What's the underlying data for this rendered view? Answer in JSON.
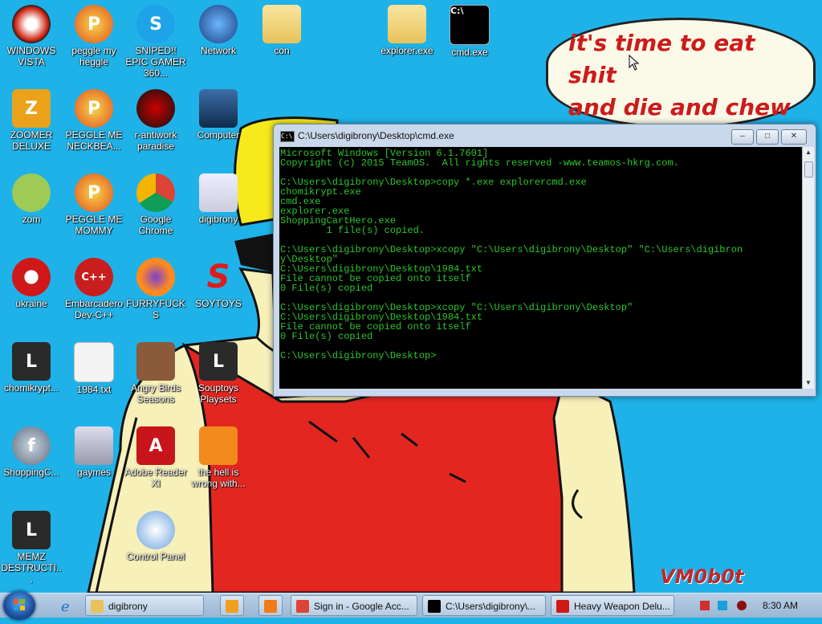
{
  "desktop_icons": [
    {
      "label": "WINDOWS VISTA",
      "icon": "vista-orb-icon"
    },
    {
      "label": "peggle my heggle",
      "icon": "peggle-icon"
    },
    {
      "label": "SNIPED!! EPIC GAMER 360...",
      "icon": "skype-icon"
    },
    {
      "label": "Network",
      "icon": "network-icon"
    },
    {
      "label": "con",
      "icon": "folder-icon"
    },
    {
      "label": "explorer.exe",
      "icon": "folder-icon"
    },
    {
      "label": "cmd.exe",
      "icon": "cmd-icon"
    },
    {
      "label": "ZOOMER DELUXE",
      "icon": "zuma-icon"
    },
    {
      "label": "PEGGLE ME NECKBEA...",
      "icon": "peggle-icon"
    },
    {
      "label": "r-antiwork paradise",
      "icon": "reddit-icon"
    },
    {
      "label": "Computer",
      "icon": "computer-icon"
    },
    {
      "label": "zom",
      "icon": "plants-icon"
    },
    {
      "label": "PEGGLE ME MOMMY",
      "icon": "peggle-icon"
    },
    {
      "label": "Google Chrome",
      "icon": "chrome-icon"
    },
    {
      "label": "digibrony",
      "icon": "user-folder-icon"
    },
    {
      "label": "ukraine",
      "icon": "radiation-icon"
    },
    {
      "label": "Embarcadero Dev-C++",
      "icon": "devcpp-icon"
    },
    {
      "label": "FURRYFUCKS",
      "icon": "firefox-icon"
    },
    {
      "label": "SOYTOYS",
      "icon": "soy-s-icon"
    },
    {
      "label": "chomikrypt...",
      "icon": "memz-icon"
    },
    {
      "label": "1984.txt",
      "icon": "text-file-icon"
    },
    {
      "label": "Angry Birds Seasons",
      "icon": "angry-birds-icon"
    },
    {
      "label": "Souptoys Playsets",
      "icon": "memz-icon"
    },
    {
      "label": "ShoppingC...",
      "icon": "flash-icon"
    },
    {
      "label": "gaymes",
      "icon": "games-folder-icon"
    },
    {
      "label": "Adobe Reader XI",
      "icon": "adobe-icon"
    },
    {
      "label": "the hell is wrong with...",
      "icon": "uc-browser-icon"
    },
    {
      "label": "MEMZ DESTRUCTI...",
      "icon": "memz-icon"
    },
    {
      "label": "Control Panel",
      "icon": "control-panel-icon"
    }
  ],
  "speech_bubble": "it's time to eat shit\nand die and chew\nbubble gum",
  "signature": "VM0b0t",
  "cmd_window": {
    "title": "C:\\Users\\digibrony\\Desktop\\cmd.exe",
    "lines": [
      "Microsoft Windows [Version 6.1.7601]",
      "Copyright (c) 2015 TeamOS.  All rights reserved -www.teamos-hkrg.com.",
      "",
      "C:\\Users\\digibrony\\Desktop>copy *.exe explorercmd.exe",
      "chomikrypt.exe",
      "cmd.exe",
      "explorer.exe",
      "ShoppingCartHero.exe",
      "        1 file(s) copied.",
      "",
      "C:\\Users\\digibrony\\Desktop>xcopy \"C:\\Users\\digibrony\\Desktop\" \"C:\\Users\\digibron",
      "y\\Desktop\"",
      "C:\\Users\\digibrony\\Desktop\\1984.txt",
      "File cannot be copied onto itself",
      "0 File(s) copied",
      "",
      "C:\\Users\\digibrony\\Desktop>xcopy \"C:\\Users\\digibrony\\Desktop\"",
      "C:\\Users\\digibrony\\Desktop\\1984.txt",
      "File cannot be copied onto itself",
      "0 File(s) copied",
      "",
      "C:\\Users\\digibrony\\Desktop>"
    ],
    "buttons": {
      "minimize": "–",
      "maximize": "□",
      "close": "✕"
    }
  },
  "taskbar": {
    "tasks": [
      {
        "label": "digibrony",
        "icon": "folder-icon"
      },
      {
        "label": "Sign in - Google Acc...",
        "icon": "chrome-icon"
      },
      {
        "label": "C:\\Users\\digibrony\\...",
        "icon": "cmd-icon"
      },
      {
        "label": "Heavy Weapon Delu...",
        "icon": "radiation-icon"
      }
    ],
    "clock": "8:30 AM"
  },
  "colors": {
    "desktop_bg": "#1fb2e8",
    "cmd_text": "#2ec52e",
    "bubble_text": "#cc1b1b"
  }
}
